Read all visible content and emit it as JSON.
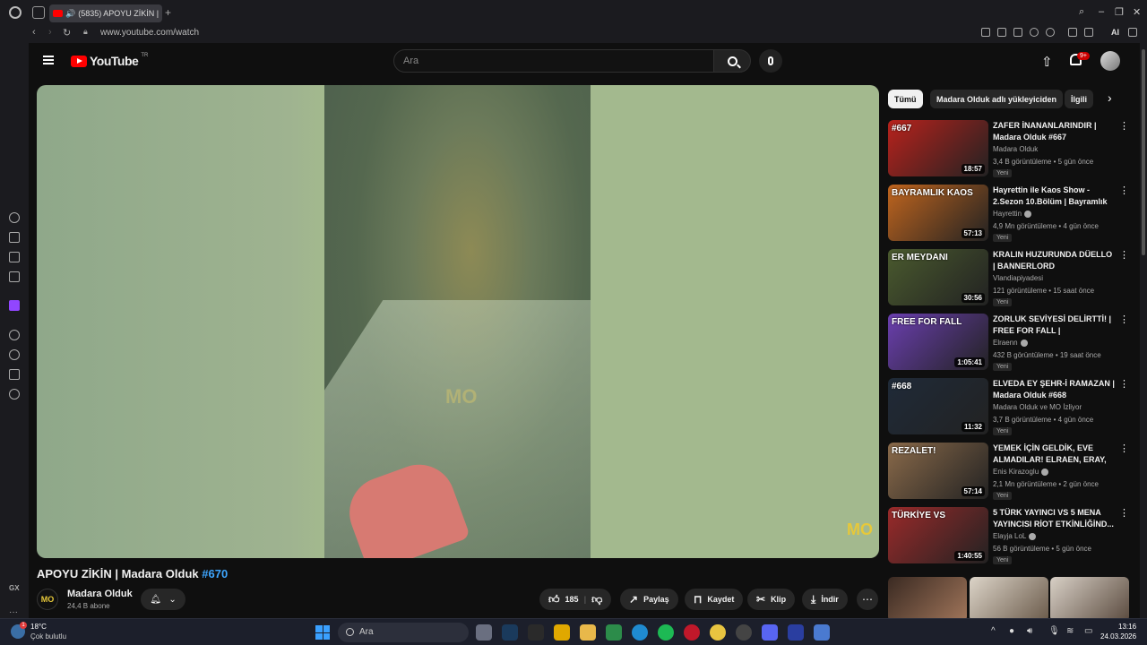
{
  "browser": {
    "tab_title": "(5835) APOYU ZİKİN |",
    "url": "www.youtube.com/watch",
    "ai_label": "AI",
    "gx_label": "GX"
  },
  "header": {
    "logo_text": "YouTube",
    "country": "TR",
    "search_placeholder": "Ara",
    "notification_count": "9+"
  },
  "video": {
    "title": "APOYU ZİKİN | Madara Olduk",
    "hashtag": "#670",
    "channel_name": "Madara Olduk",
    "channel_initials": "MO",
    "subscribers": "24,4 B abone",
    "likes": "185",
    "share_label": "Paylaş",
    "save_label": "Kaydet",
    "clip_label": "Klip",
    "download_label": "İndir",
    "watermark": "MO"
  },
  "chips": [
    "Tümü",
    "Madara Olduk adlı yükleyiciden",
    "İlgili"
  ],
  "recommendations": [
    {
      "title": "ZAFER İNANANLARINDIR | Madara Olduk #667",
      "channel": "Madara Olduk",
      "verified": false,
      "views": "3,4 B görüntüleme",
      "age": "5 gün önce",
      "duration": "18:57",
      "new": "Yeni",
      "thumb_text": "#667",
      "color": "#b8221c"
    },
    {
      "title": "Hayrettin ile Kaos Show - 2.Sezon 10.Bölüm | Bayramlık ...",
      "channel": "Hayrettin",
      "verified": true,
      "views": "4,9 Mn görüntüleme",
      "age": "4 gün önce",
      "duration": "57:13",
      "new": "Yeni",
      "thumb_text": "BAYRAMLIK KAOS",
      "color": "#c0651e"
    },
    {
      "title": "KRALIN HUZURUNDA DÜELLO | BANNERLORD",
      "channel": "Vlandiapiyadesi",
      "verified": false,
      "views": "121 görüntüleme",
      "age": "15 saat önce",
      "duration": "30:56",
      "new": "Yeni",
      "thumb_text": "ER MEYDANI",
      "color": "#4a5a2e"
    },
    {
      "title": "ZORLUK SEVİYESİ DELİRTTİ! | FREE FOR FALL |",
      "channel": "Elraenn",
      "verified": true,
      "views": "432 B görüntüleme",
      "age": "19 saat önce",
      "duration": "1:05:41",
      "new": "Yeni",
      "thumb_text": "FREE FOR FALL",
      "color": "#6b3fb0"
    },
    {
      "title": "ELVEDA EY ŞEHR-İ RAMAZAN | Madara Olduk #668",
      "channel": "Madara Olduk ve MO İzliyor",
      "verified": false,
      "views": "3,7 B görüntüleme",
      "age": "4 gün önce",
      "duration": "11:32",
      "new": "Yeni",
      "thumb_text": "#668",
      "color": "#1f2a38"
    },
    {
      "title": "YEMEK İÇİN GELDİK, EVE ALMADILAR! ELRAEN, ERAY, ...",
      "channel": "Enis Kirazoglu",
      "verified": true,
      "views": "2,1 Mn görüntüleme",
      "age": "2 gün önce",
      "duration": "57:14",
      "new": "Yeni",
      "thumb_text": "REZALET!",
      "color": "#8a6a4a"
    },
    {
      "title": "5 TÜRK YAYINCI VS 5 MENA YAYINCISI RİOT ETKİNLİĞİND...",
      "channel": "Elayja LoL",
      "verified": true,
      "views": "56 B görüntüleme",
      "age": "5 gün önce",
      "duration": "1:40:55",
      "new": "Yeni",
      "thumb_text": "TÜRKİYE VS",
      "color": "#9a2a2a"
    }
  ],
  "taskbar": {
    "temperature": "18°C",
    "weather": "Çok bulutlu",
    "weather_badge": "1",
    "search_label": "Ara",
    "time": "13:16",
    "date": "24.03.2026"
  },
  "colors": {
    "accent_red": "#ff0000",
    "hashtag_blue": "#3ea6ff",
    "watermark_yellow": "#e6c83a"
  }
}
